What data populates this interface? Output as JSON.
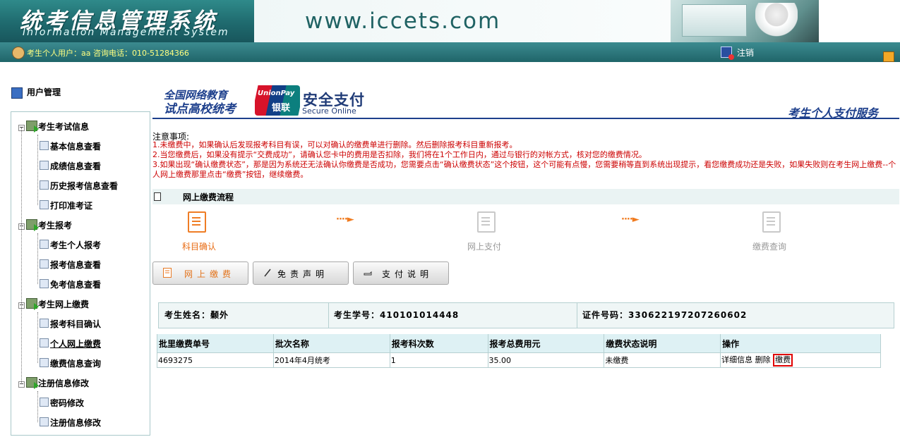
{
  "header": {
    "logo_cn": "统考信息管理系统",
    "logo_en": "Information Management System",
    "url": "www.iccets.com"
  },
  "statusbar": {
    "user_text": "考生个人用户：aa 咨询电话：010-51284366",
    "logout_label": "注销"
  },
  "sidebar": {
    "title": "用户管理",
    "groups": [
      {
        "label": "考生考试信息",
        "items": [
          "基本信息查看",
          "成绩信息查看",
          "历史报考信息查看",
          "打印准考证"
        ]
      },
      {
        "label": "考生报考",
        "items": [
          "考生个人报考",
          "报考信息查看",
          "免考信息查看"
        ]
      },
      {
        "label": "考生网上缴费",
        "items": [
          "报考科目确认",
          "个人网上缴费",
          "缴费信息查询"
        ]
      },
      {
        "label": "注册信息修改",
        "items": [
          "密码修改",
          "注册信息修改"
        ]
      }
    ]
  },
  "payment_header": {
    "edu_line1": "全国网络教育",
    "edu_line2": "试点高校统考",
    "unionpay_en": "UnionPay",
    "unionpay_cn": "银联",
    "secure_cn": "安全支付",
    "secure_en": "Secure Online",
    "service_title": "考生个人支付服务"
  },
  "notices": {
    "title": "注意事项:",
    "items": [
      "1.未缴费中，如果确认后发现报考科目有误，可以对确认的缴费单进行删除。然后删除报考科目重新报考。",
      "2.当您缴费后，如果没有提示“交费成功”，请确认您卡中的费用是否扣除，我们将在1个工作日内，通过与银行的对帐方式，核对您的缴费情况。",
      "3.如果出现“确认缴费状态”，那是因为系统还无法确认你缴费是否成功，您需要点击“确认缴费状态”这个按钮，这个可能有点慢，您需要稍等直到系统出现提示，看您缴费成功还是失败，如果失败则在考生网上缴费--个人网上缴费那里点击“缴费”按钮，继续缴费。"
    ]
  },
  "process": {
    "title": "网上缴费流程",
    "steps": [
      "科目确认",
      "网上支付",
      "缴费查询"
    ],
    "arrow": "····►"
  },
  "tabs": {
    "online_pay": "网上缴费",
    "disclaimer": "免责声明",
    "payment_info": "支付说明"
  },
  "student": {
    "name_label": "考生姓名：",
    "name": "颡外",
    "id_label": "考生学号：",
    "id": "410101014448",
    "cert_label": "证件号码：",
    "cert": "330622197207260602"
  },
  "table": {
    "headers": [
      "批里缴费单号",
      "批次名称",
      "报考科次数",
      "报考总费用元",
      "缴费状态说明",
      "操作"
    ],
    "rows": [
      {
        "order": "4693275",
        "batch": "2014年4月统考",
        "count": "1",
        "total": "35.00",
        "status": "未缴费",
        "actions": {
          "detail": "详细信息",
          "delete": "删除",
          "pay": "缴费"
        }
      }
    ]
  },
  "colors": {
    "brand_teal": "#1f6569",
    "accent_orange": "#e86a11",
    "notice_red": "#cc0000",
    "link_blue": "#1d3f8c"
  }
}
